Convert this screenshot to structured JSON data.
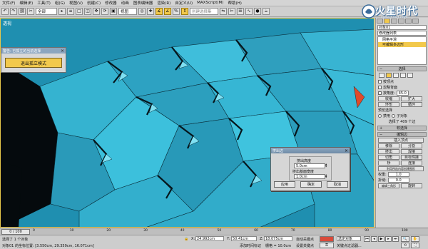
{
  "menu": [
    "文件(F)",
    "编辑(E)",
    "工具(T)",
    "组(G)",
    "视图(V)",
    "创建(C)",
    "修改器",
    "动画",
    "图表编辑器",
    "渲染(R)",
    "自定义(U)",
    "MAXScript(M)",
    "帮助(H)"
  ],
  "toolbar": {
    "filter_value": "全部",
    "view_value": "视图",
    "named_selection_placeholder": "创建选择集"
  },
  "logo": {
    "text": "火星时代",
    "url": "www.hxsd.com"
  },
  "viewport": {
    "label": "透视"
  },
  "warning_window": {
    "title": "警告: 已孤立的当前选择",
    "button_label": "退出孤立模式"
  },
  "dialog": {
    "title": "挤出边",
    "height_label": "挤出高度",
    "height_value": "5.0cm",
    "width_label": "挤出基面宽度",
    "width_value": "1.0cm",
    "apply_label": "应用",
    "ok_label": "确定",
    "cancel_label": "取消"
  },
  "panel": {
    "object_name": "对象01",
    "modifier_list_label": "修改器列表",
    "stack": [
      "网格平滑",
      "可编辑多边形"
    ],
    "selected_stack_index": 1,
    "selection_rollout": "选择",
    "by_vertex": "按顶点",
    "ignore_backfacing": "忽略背面",
    "by_angle": "按角度:",
    "angle_value": "45.0",
    "shrink": "收缩",
    "grow": "扩大",
    "ring": "环形",
    "loop": "循环",
    "preview_label": "预览选择",
    "preview_off": "禁用",
    "preview_subobj": "子对象",
    "preview_multi": "多个",
    "selected_count": "选择了 409 个边",
    "soft_selection": "软选择",
    "edit_edges": "编辑边",
    "insert_vertex": "插入顶点",
    "remove": "移除",
    "split": "分割",
    "extrude": "挤出",
    "weld": "焊接",
    "chamfer": "切角",
    "target_weld": "目标焊接",
    "bridge": "桥",
    "connect": "连接",
    "create_shape": "利用所选内容创建图形",
    "weight_label": "权重:",
    "weight_value": "1.0",
    "crease_label": "折缝:",
    "crease_value": "0.0",
    "edit_tri": "编辑三角形",
    "rotate": "旋转"
  },
  "timeline": {
    "frame_counter": "0 / 100",
    "ticks": [
      "0",
      "10",
      "20",
      "30",
      "40",
      "50",
      "60",
      "70",
      "80",
      "90",
      "100"
    ]
  },
  "status": {
    "selected": "选择了 1 个对象",
    "prompt": "对象01 的坐标位置: [3.550cm, 29.359cm, 16.071cm]",
    "x_value": "24.992cm",
    "y_value": "50.41cm",
    "z_value": "18.075cm",
    "grid": "栅格 = 10.0cm",
    "add_time_tag": "添加时间标记",
    "auto_key": "自动关键点",
    "set_key": "设置关键点",
    "key_filter": "关键点过滤器...",
    "selected_object": "选定对象"
  },
  "colors": {
    "accent": "#f2c94c",
    "viewport": "#2aa6c4",
    "mesh_face": "#3bbcd6"
  }
}
